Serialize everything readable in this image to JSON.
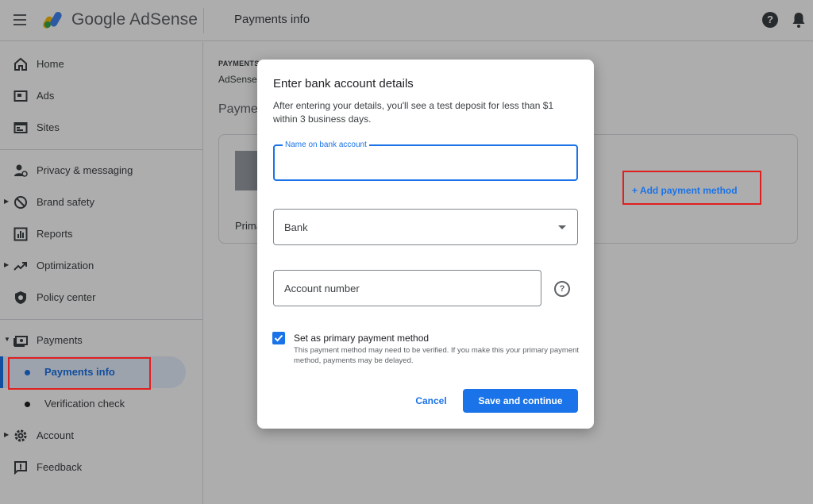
{
  "header": {
    "brand": "Google AdSense",
    "page_title": "Payments info",
    "help_glyph": "?"
  },
  "sidebar": {
    "items": [
      {
        "label": "Home",
        "icon": "home-icon"
      },
      {
        "label": "Ads",
        "icon": "ads-icon"
      },
      {
        "label": "Sites",
        "icon": "sites-icon"
      },
      {
        "label": "Privacy & messaging",
        "icon": "privacy-icon"
      },
      {
        "label": "Brand safety",
        "icon": "block-icon"
      },
      {
        "label": "Reports",
        "icon": "reports-icon"
      },
      {
        "label": "Optimization",
        "icon": "trending-icon"
      },
      {
        "label": "Policy center",
        "icon": "shield-icon"
      },
      {
        "label": "Payments",
        "icon": "payments-icon"
      },
      {
        "label": "Account",
        "icon": "gear-icon"
      },
      {
        "label": "Feedback",
        "icon": "feedback-icon"
      }
    ],
    "payments_sub": [
      {
        "label": "Payments info",
        "active": true
      },
      {
        "label": "Verification check",
        "active": false
      }
    ]
  },
  "main": {
    "crumb_small": "PAYMENTS",
    "crumb_sub": "AdSense",
    "title": "Payme",
    "card_primary": "Prima",
    "add_method": "+ Add payment method"
  },
  "dialog": {
    "title": "Enter bank account details",
    "description": "After entering your details, you'll see a test deposit for less than $1 within 3 business days.",
    "name_field_label": "Name on bank account",
    "bank_field": "Bank",
    "account_field": "Account number",
    "help_glyph": "?",
    "primary_checkbox_label": "Set as primary payment method",
    "primary_checkbox_checked": true,
    "primary_checkbox_help": "This payment method may need to be verified. If you make this your primary payment method, payments may be delayed.",
    "cancel_label": "Cancel",
    "save_label": "Save and continue"
  },
  "colors": {
    "accent": "#1a73e8",
    "highlight_box": "#e02020"
  }
}
